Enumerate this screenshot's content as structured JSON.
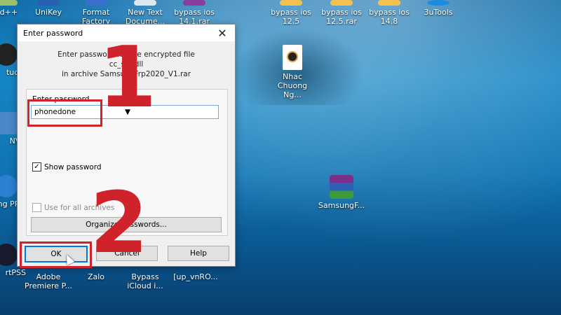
{
  "desktop": {
    "top_icons": [
      {
        "label": "ad++",
        "icon": "notepad-plus-icon"
      },
      {
        "label": "UniKey",
        "icon": "unikey-icon"
      },
      {
        "label": "Format Factory",
        "icon": "format-factory-icon"
      },
      {
        "label": "New Text Docume...",
        "icon": "text-document-icon"
      },
      {
        "label": "bypass ios 14.1.rar",
        "icon": "rar-archive-icon"
      },
      {
        "label": "bypass ios 12.5",
        "icon": "folder-icon"
      },
      {
        "label": "bypass ios 12.5.rar",
        "icon": "rar-archive-icon"
      },
      {
        "label": "bypass ios 14.8",
        "icon": "folder-icon"
      },
      {
        "label": "3uTools",
        "icon": "3utools-icon"
      }
    ],
    "music_icon": {
      "label": "Nhac Chuong Ng...",
      "icon": "music-file-icon"
    },
    "samsung_rar": {
      "label": "SamsungF...",
      "icon": "winrar-archive-icon"
    },
    "left_icons": [
      {
        "label": "tudio",
        "icon": "obs-studio-icon"
      },
      {
        "label": "NVR",
        "icon": "nvr-icon"
      },
      {
        "label": "sung PRO",
        "icon": "samsung-pro-icon"
      },
      {
        "label": "rtPSS",
        "icon": "smartpss-icon"
      }
    ],
    "bottom_icons": [
      {
        "label": "Adobe Premiere P...",
        "icon": "premiere-icon"
      },
      {
        "label": "Zalo",
        "icon": "zalo-icon"
      },
      {
        "label": "Bypass iCloud i...",
        "icon": "bypass-icloud-icon"
      },
      {
        "label": "[up_vnRO...",
        "icon": "file-icon"
      }
    ]
  },
  "dialog": {
    "title": "Enter password",
    "info_line1": "Enter password for the encrypted file",
    "info_line2": "cc_s-1.dll",
    "info_line3": "in archive SamsungFrp2020_V1.rar",
    "group_label": "Enter password",
    "password_value": "phonedone",
    "show_password_label": "Show password",
    "show_password_checked": "✓",
    "use_for_all_label": "Use for all archives",
    "organize_label": "Organize passwords...",
    "ok_label": "OK",
    "cancel_label": "Cancel",
    "help_label": "Help"
  },
  "annotations": {
    "step1": "1",
    "step2": "2"
  },
  "colors": {
    "annotation_red": "#d0222a",
    "accent": "#0078d7"
  }
}
